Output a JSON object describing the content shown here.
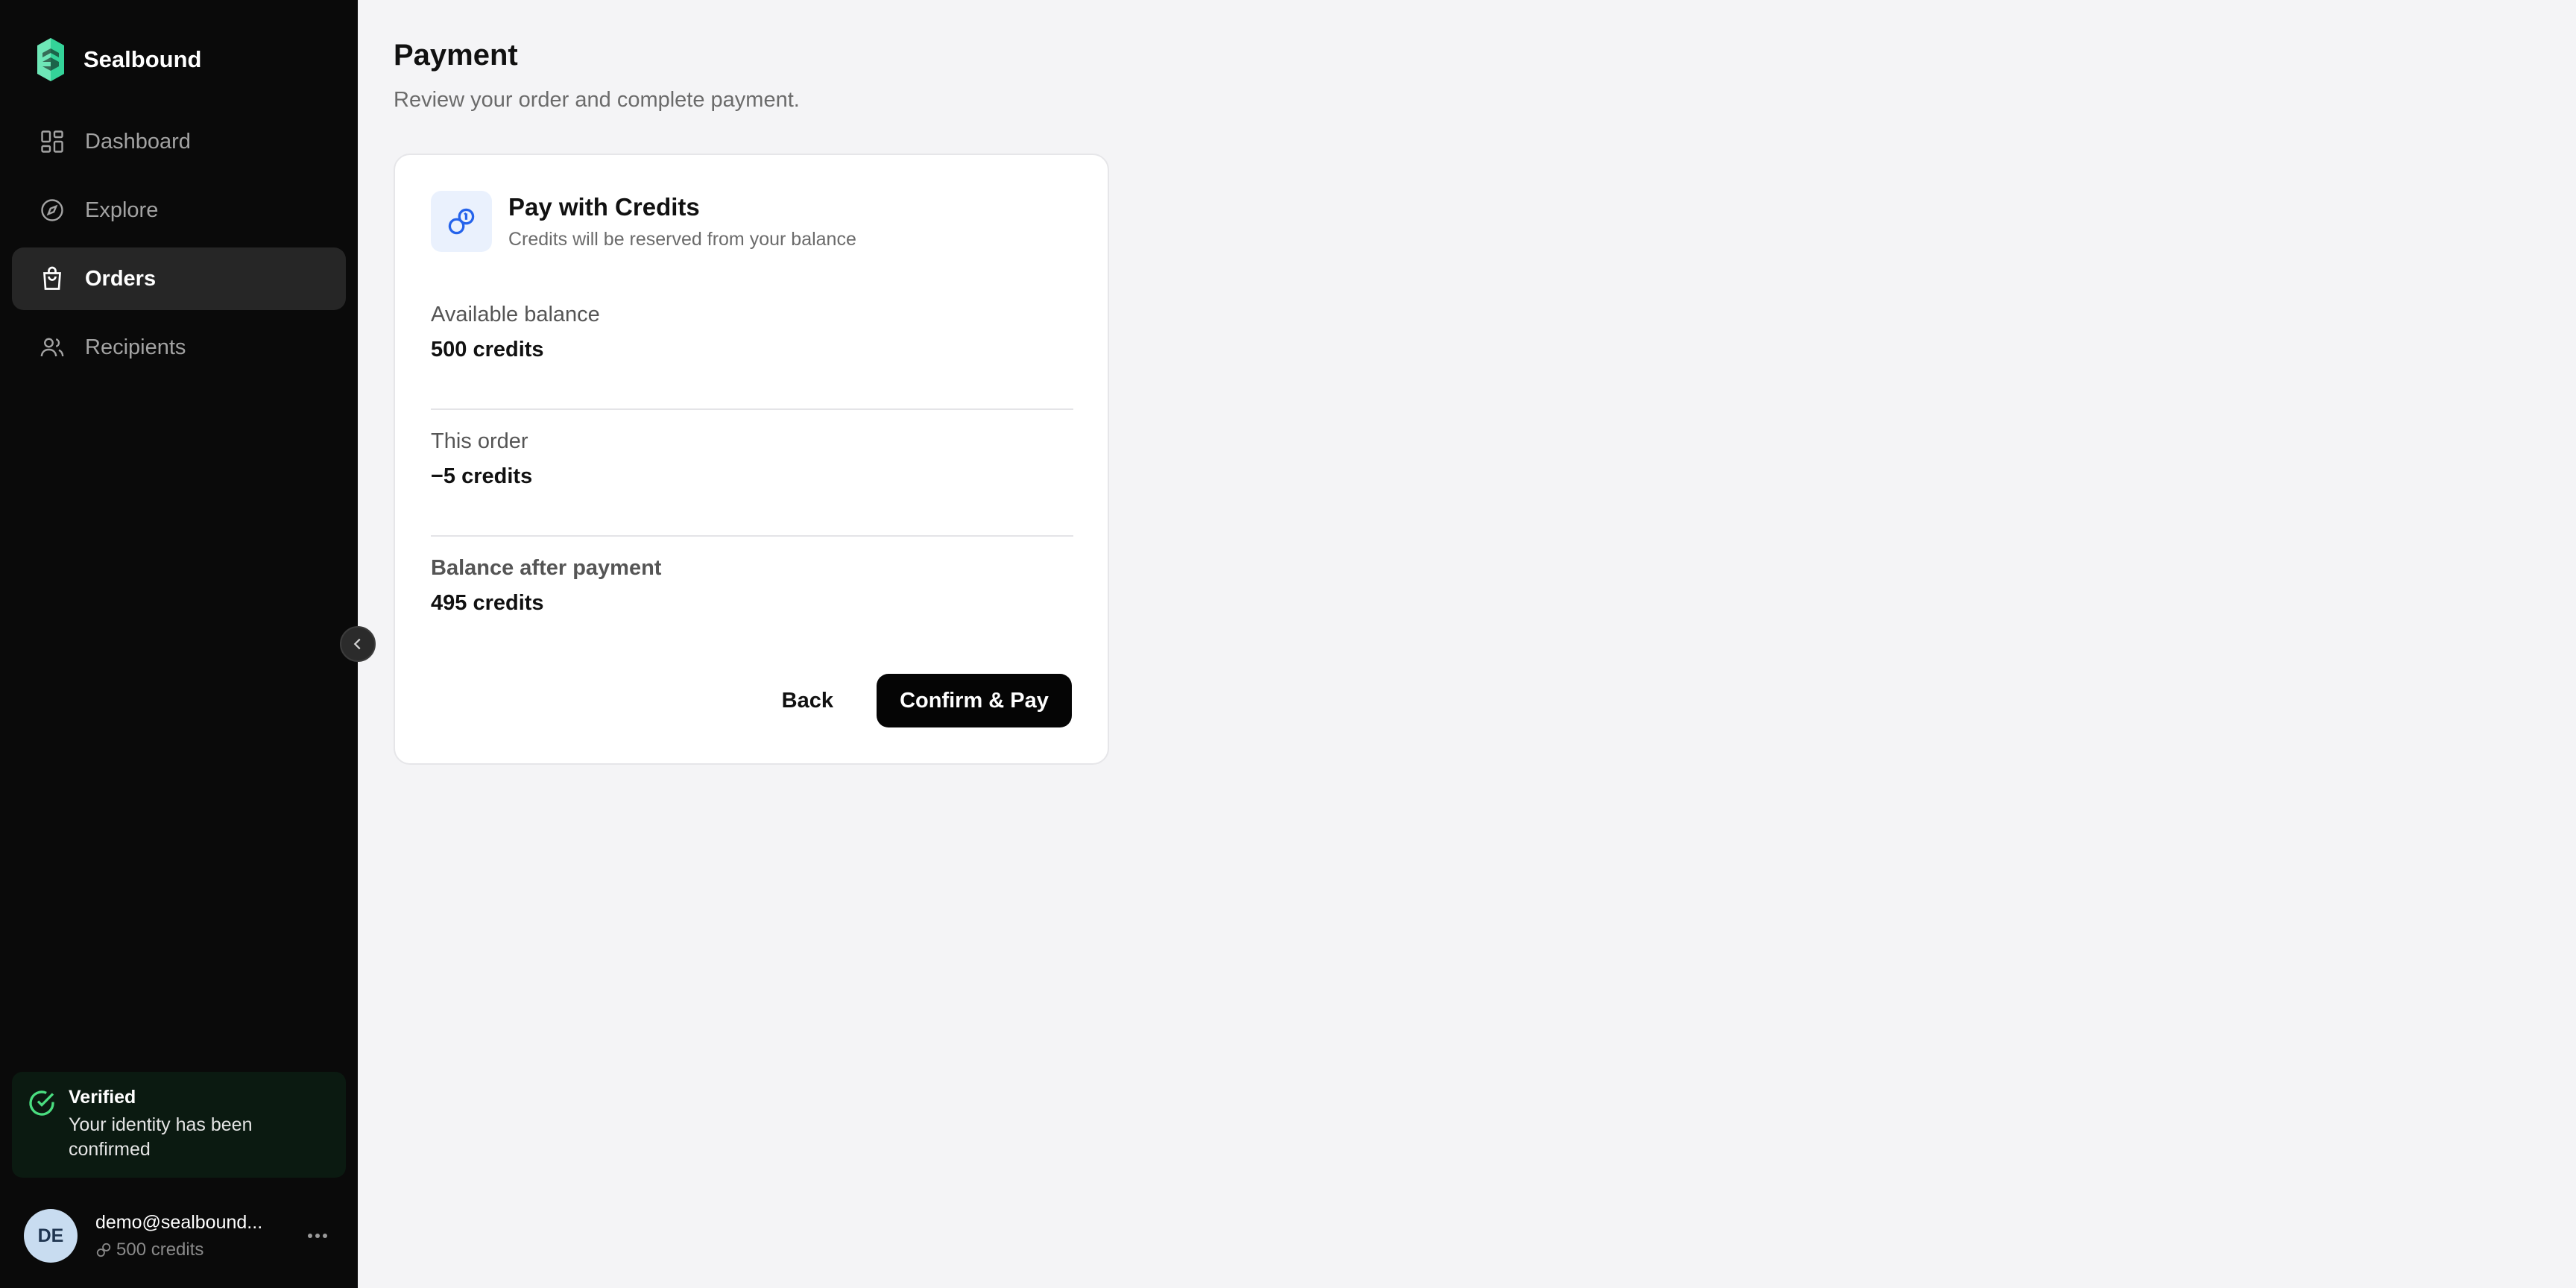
{
  "brand": {
    "name": "Sealbound"
  },
  "sidebar": {
    "items": [
      {
        "label": "Dashboard",
        "icon": "dashboard-icon",
        "active": false
      },
      {
        "label": "Explore",
        "icon": "compass-icon",
        "active": false
      },
      {
        "label": "Orders",
        "icon": "shopping-bag-icon",
        "active": true
      },
      {
        "label": "Recipients",
        "icon": "users-icon",
        "active": false
      }
    ],
    "verification": {
      "title": "Verified",
      "message": "Your identity has been confirmed"
    },
    "user": {
      "initials": "DE",
      "email": "demo@sealbound...",
      "credits": "500 credits"
    }
  },
  "page": {
    "title": "Payment",
    "subtitle": "Review your order and complete payment."
  },
  "payment": {
    "method_title": "Pay with Credits",
    "method_subtitle": "Credits will be reserved from your balance",
    "available_label": "Available balance",
    "available_value": "500 credits",
    "order_label": "This order",
    "order_value": "−5 credits",
    "after_label": "Balance after payment",
    "after_value": "495 credits",
    "back_label": "Back",
    "confirm_label": "Confirm & Pay"
  },
  "colors": {
    "sidebar_bg": "#0a0a0a",
    "active_nav_bg": "#262626",
    "brand_accent": "#6ee7b7",
    "verified_green": "#4ade80",
    "credit_icon_blue": "#2563eb",
    "primary_button": "#050505"
  }
}
